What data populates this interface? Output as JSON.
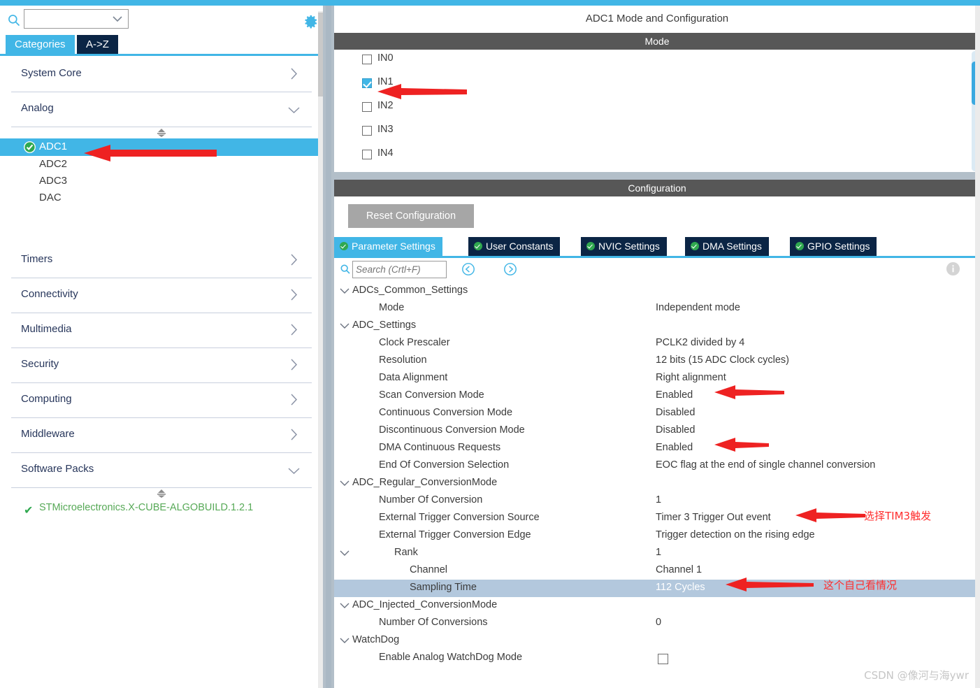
{
  "left_panel": {
    "search": {
      "value": "",
      "placeholder": ""
    },
    "gear_tooltip": "Settings",
    "tabs": [
      {
        "id": "categories",
        "label": "Categories",
        "active": true
      },
      {
        "id": "a-to-z",
        "label": "A->Z",
        "active": false
      }
    ],
    "categories": [
      {
        "label": "System Core",
        "expanded": false
      },
      {
        "label": "Analog",
        "expanded": true
      },
      {
        "label": "Timers",
        "expanded": false
      },
      {
        "label": "Connectivity",
        "expanded": false
      },
      {
        "label": "Multimedia",
        "expanded": false
      },
      {
        "label": "Security",
        "expanded": false
      },
      {
        "label": "Computing",
        "expanded": false
      },
      {
        "label": "Middleware",
        "expanded": false
      },
      {
        "label": "Software Packs",
        "expanded": true
      }
    ],
    "analog_items": [
      {
        "label": "ADC1",
        "selected": true,
        "configured": true
      },
      {
        "label": "ADC2",
        "selected": false,
        "configured": false
      },
      {
        "label": "ADC3",
        "selected": false,
        "configured": false
      },
      {
        "label": "DAC",
        "selected": false,
        "configured": false
      }
    ],
    "software_packs": [
      {
        "label": "STMicroelectronics.X-CUBE-ALGOBUILD.1.2.1",
        "checked": true
      }
    ]
  },
  "right_panel": {
    "title": "ADC1 Mode and Configuration",
    "mode_header": "Mode",
    "configuration_header": "Configuration",
    "mode_channels": [
      {
        "label": "IN0",
        "checked": false
      },
      {
        "label": "IN1",
        "checked": true
      },
      {
        "label": "IN2",
        "checked": false
      },
      {
        "label": "IN3",
        "checked": false
      },
      {
        "label": "IN4",
        "checked": false
      }
    ],
    "reset_button": "Reset Configuration",
    "config_tabs": [
      {
        "label": "Parameter Settings",
        "active": true
      },
      {
        "label": "User Constants",
        "active": false
      },
      {
        "label": "NVIC Settings",
        "active": false
      },
      {
        "label": "DMA Settings",
        "active": false
      },
      {
        "label": "GPIO Settings",
        "active": false
      }
    ],
    "search": {
      "value": "",
      "placeholder": "Search (Crtl+F)"
    },
    "parameters": [
      {
        "name": "ADCs_Common_Settings",
        "value": "",
        "level": 0,
        "twisty": "down",
        "highlight": false
      },
      {
        "name": "Mode",
        "value": "Independent mode",
        "level": 1,
        "twisty": "",
        "highlight": false
      },
      {
        "name": "ADC_Settings",
        "value": "",
        "level": 0,
        "twisty": "down",
        "highlight": false
      },
      {
        "name": "Clock Prescaler",
        "value": "PCLK2 divided by 4",
        "level": 1,
        "twisty": "",
        "highlight": false
      },
      {
        "name": "Resolution",
        "value": "12 bits (15 ADC Clock cycles)",
        "level": 1,
        "twisty": "",
        "highlight": false
      },
      {
        "name": "Data Alignment",
        "value": "Right alignment",
        "level": 1,
        "twisty": "",
        "highlight": false
      },
      {
        "name": "Scan Conversion Mode",
        "value": "Enabled",
        "level": 1,
        "twisty": "",
        "highlight": false
      },
      {
        "name": "Continuous Conversion Mode",
        "value": "Disabled",
        "level": 1,
        "twisty": "",
        "highlight": false
      },
      {
        "name": "Discontinuous Conversion Mode",
        "value": "Disabled",
        "level": 1,
        "twisty": "",
        "highlight": false
      },
      {
        "name": "DMA Continuous Requests",
        "value": "Enabled",
        "level": 1,
        "twisty": "",
        "highlight": false
      },
      {
        "name": "End Of Conversion Selection",
        "value": "EOC flag at the end of single channel conversion",
        "level": 1,
        "twisty": "",
        "highlight": false
      },
      {
        "name": "ADC_Regular_ConversionMode",
        "value": "",
        "level": 0,
        "twisty": "down",
        "highlight": false
      },
      {
        "name": "Number Of Conversion",
        "value": "1",
        "level": 1,
        "twisty": "",
        "highlight": false
      },
      {
        "name": "External Trigger Conversion Source",
        "value": "Timer 3 Trigger Out event",
        "level": 1,
        "twisty": "",
        "highlight": false
      },
      {
        "name": "External Trigger Conversion Edge",
        "value": "Trigger detection on the rising edge",
        "level": 1,
        "twisty": "",
        "highlight": false
      },
      {
        "name": "Rank",
        "value": "1",
        "level": 2,
        "twisty": "down",
        "highlight": false
      },
      {
        "name": "Channel",
        "value": "Channel 1",
        "level": 3,
        "twisty": "",
        "highlight": false
      },
      {
        "name": "Sampling Time",
        "value": "112 Cycles",
        "level": 3,
        "twisty": "",
        "highlight": true
      },
      {
        "name": "ADC_Injected_ConversionMode",
        "value": "",
        "level": 0,
        "twisty": "down",
        "highlight": false
      },
      {
        "name": "Number Of Conversions",
        "value": "0",
        "level": 1,
        "twisty": "",
        "highlight": false
      },
      {
        "name": "WatchDog",
        "value": "",
        "level": 0,
        "twisty": "down",
        "highlight": false
      },
      {
        "name": "Enable Analog WatchDog Mode",
        "value": "",
        "level": 1,
        "twisty": "",
        "highlight": false,
        "checkbox": true
      }
    ]
  },
  "annotations": [
    {
      "id": "note-adc1",
      "text": "",
      "target": "ADC1 sidebar item"
    },
    {
      "id": "note-in1",
      "text": "",
      "target": "IN1 checkbox"
    },
    {
      "id": "note-scan",
      "text": "",
      "target": "Scan Conversion Mode value"
    },
    {
      "id": "note-dma",
      "text": "",
      "target": "DMA Continuous Requests value"
    },
    {
      "id": "note-trigger",
      "text": "选择TIM3触发",
      "target": "External Trigger Conversion Source"
    },
    {
      "id": "note-sampling",
      "text": "这个自己看情况",
      "target": "Sampling Time"
    }
  ],
  "watermark": "CSDN @像河与海ywr",
  "colors": {
    "accent": "#41b6e6",
    "tab_dark": "#0b2545",
    "section_header": "#575757",
    "highlight_row": "#b3c8dd",
    "annotation_red": "#ff2d2d",
    "pack_green": "#57a957"
  }
}
